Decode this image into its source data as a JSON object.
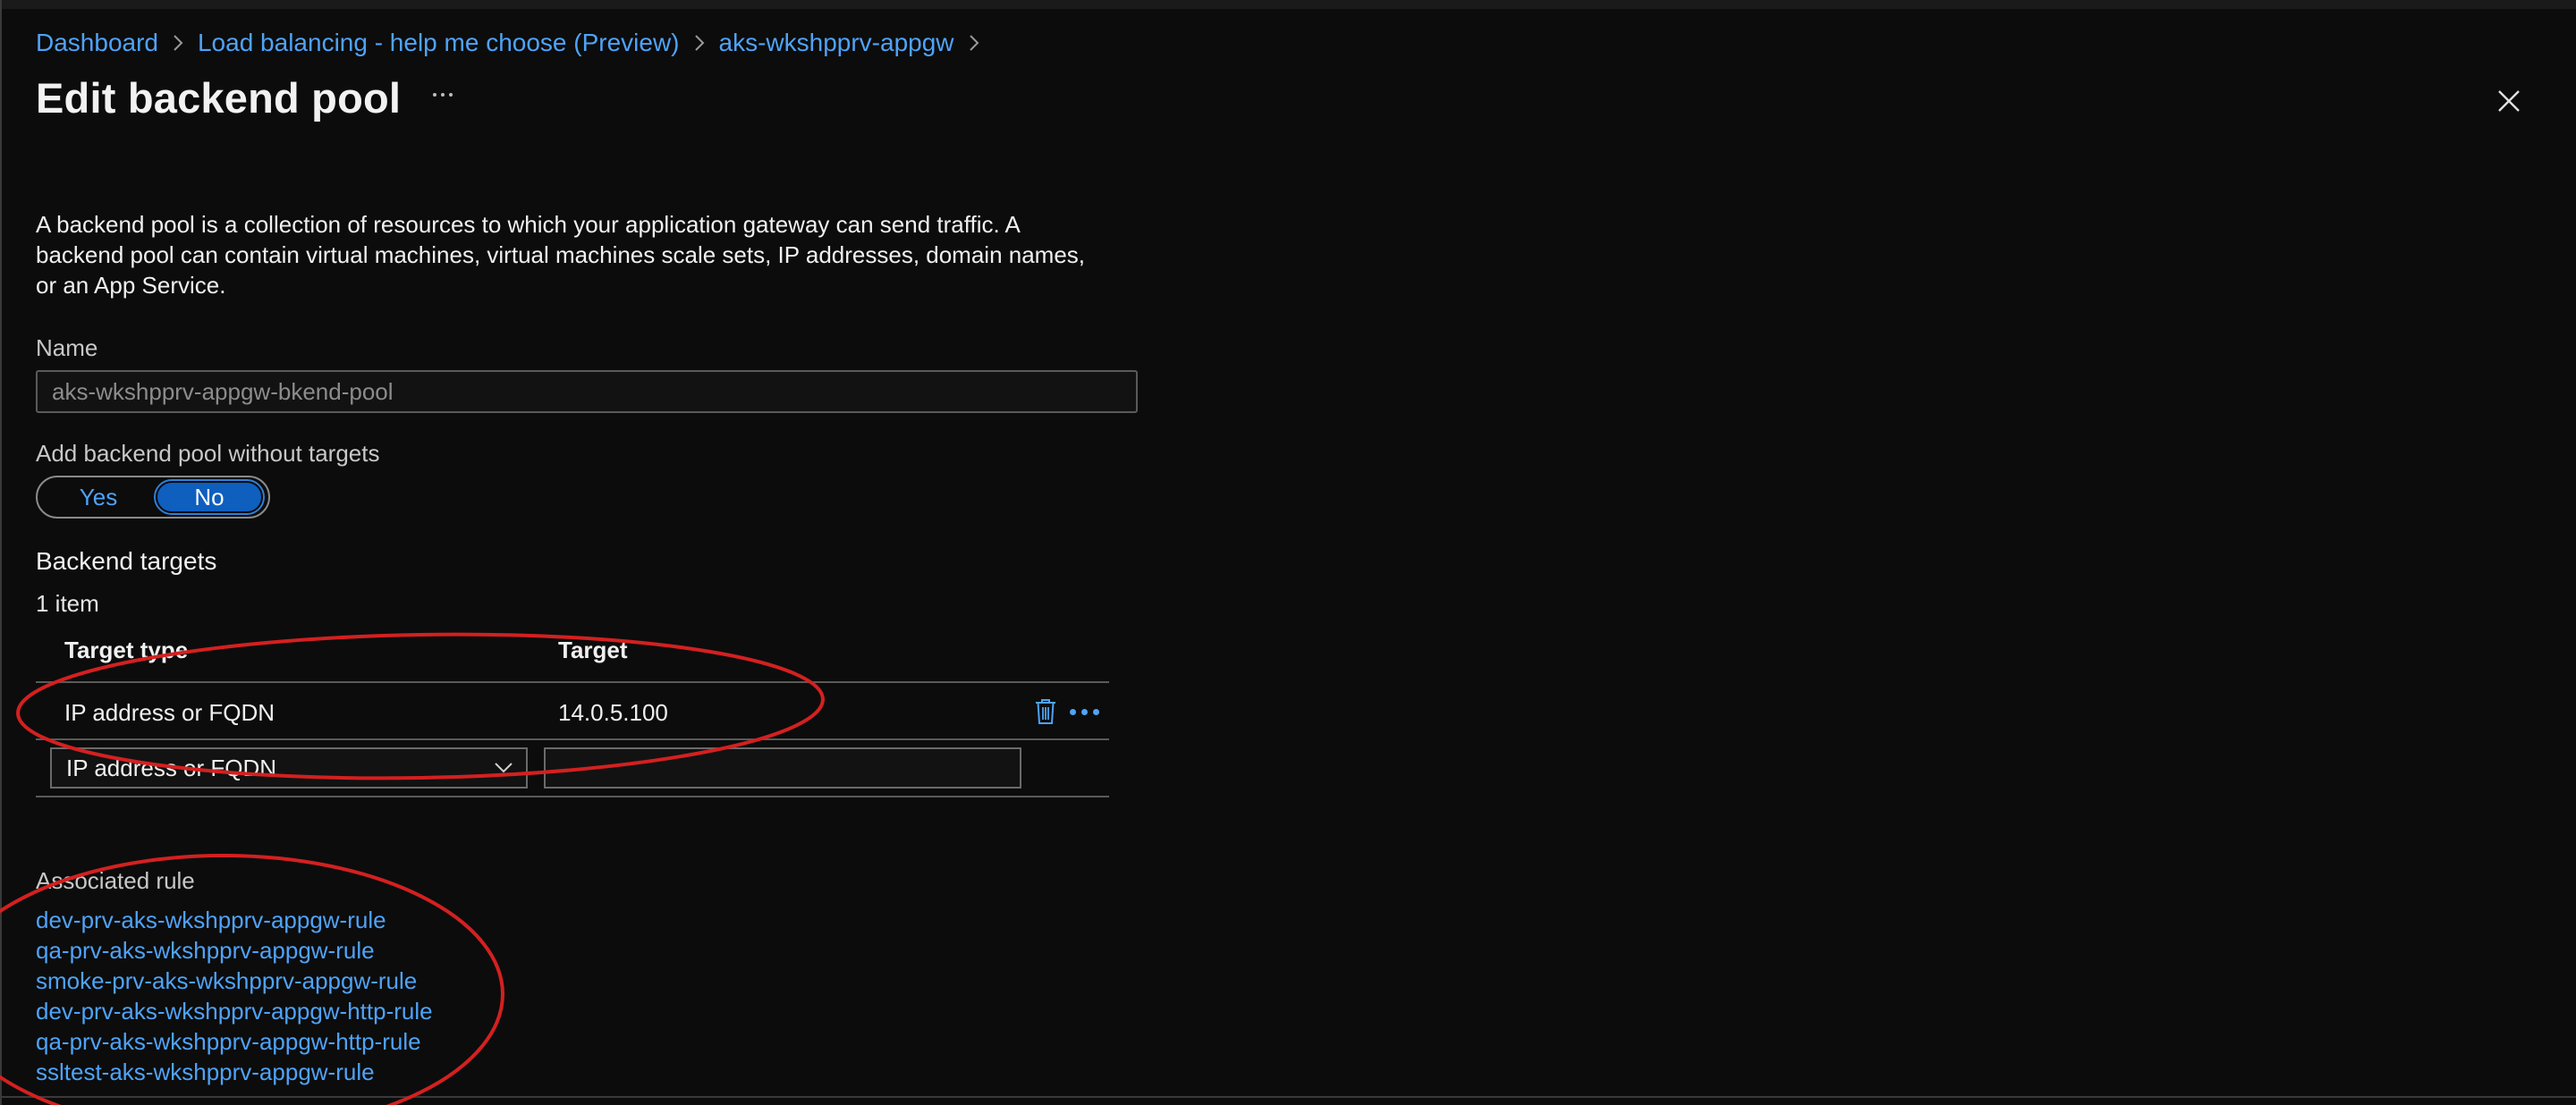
{
  "breadcrumb": {
    "items": [
      "Dashboard",
      "Load balancing - help me choose (Preview)",
      "aks-wkshpprv-appgw"
    ]
  },
  "title": "Edit backend pool",
  "description": "A backend pool is a collection of resources to which your application gateway can send traffic. A backend pool can contain virtual machines, virtual machines scale sets, IP addresses, domain names, or an App Service.",
  "name_field": {
    "label": "Name",
    "value": "aks-wkshpprv-appgw-bkend-pool"
  },
  "without_targets": {
    "label": "Add backend pool without targets",
    "options": [
      "Yes",
      "No"
    ],
    "selected": "No"
  },
  "backend_targets": {
    "title": "Backend targets",
    "count": "1 item",
    "columns": [
      "Target type",
      "Target"
    ],
    "rows": [
      {
        "type": "IP address or FQDN",
        "target": "14.0.5.100"
      }
    ],
    "new_row": {
      "type": "IP address or FQDN",
      "target": ""
    }
  },
  "associated": {
    "label": "Associated rule",
    "rules": [
      "dev-prv-aks-wkshpprv-appgw-rule",
      "qa-prv-aks-wkshpprv-appgw-rule",
      "smoke-prv-aks-wkshpprv-appgw-rule",
      "dev-prv-aks-wkshpprv-appgw-http-rule",
      "qa-prv-aks-wkshpprv-appgw-http-rule",
      "ssltest-aks-wkshpprv-appgw-rule"
    ]
  },
  "colors": {
    "background": "#0c0c0c",
    "link": "#4fa3f7",
    "toggle_selected": "#0f5fbf",
    "annotation": "#d42020"
  },
  "icons": [
    "chevron-right-icon",
    "more-icon",
    "close-icon",
    "trash-icon",
    "chevron-down-icon"
  ]
}
